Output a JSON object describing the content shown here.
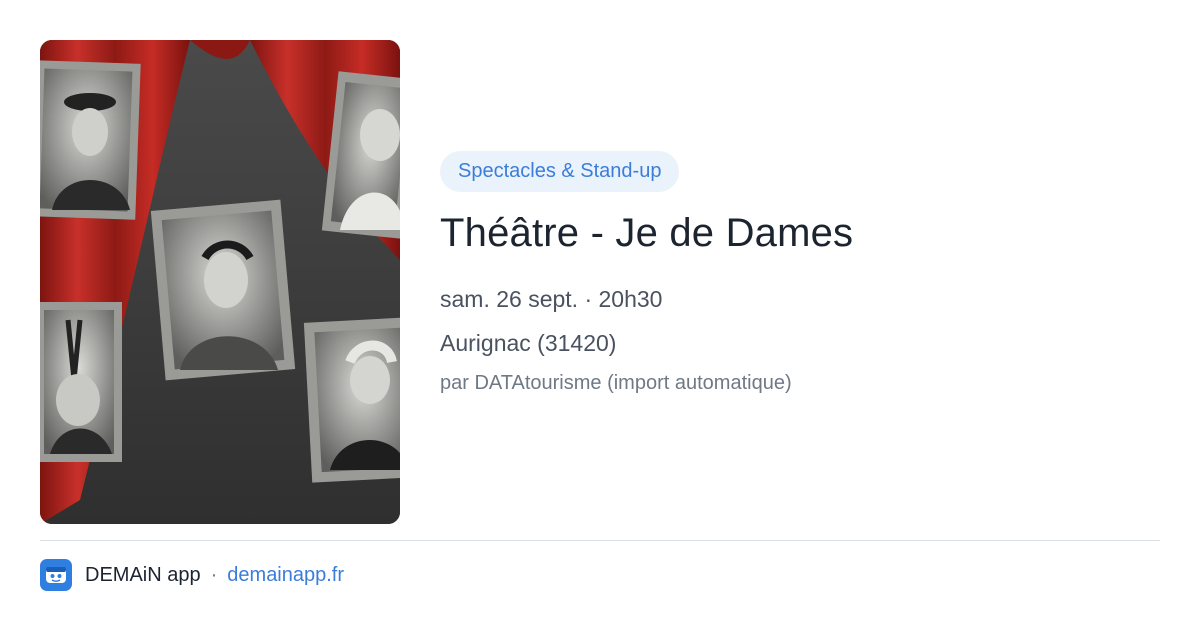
{
  "event": {
    "category": "Spectacles & Stand-up",
    "title": "Théâtre - Je de Dames",
    "datetime": "sam. 26 sept. · 20h30",
    "location": "Aurignac (31420)",
    "source": "par DATAtourisme (import automatique)"
  },
  "poster": {
    "icon": "event-poster-image",
    "colors": {
      "curtain": "#b5231f",
      "background": "#3b3b3b",
      "frame": "#9a9a96"
    }
  },
  "footer": {
    "app_name": "DEMAiN app",
    "separator": "·",
    "link": "demainapp.fr",
    "icon": "demain-logo-icon",
    "accent": "#2f7fe0"
  }
}
